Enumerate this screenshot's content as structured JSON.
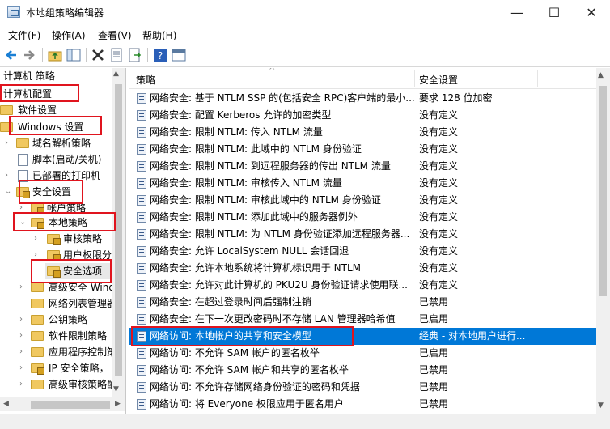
{
  "window": {
    "title": "本地组策略编辑器",
    "minimize_glyph": "—",
    "maximize_glyph": "☐",
    "close_glyph": "✕"
  },
  "menu": [
    "文件(F)",
    "操作(A)",
    "查看(V)",
    "帮助(H)"
  ],
  "toolbar_icons": [
    "back-arrow-icon",
    "forward-arrow-icon",
    "up-folder-icon",
    "show-hide-tree-icon",
    "delete-icon",
    "properties-icon",
    "refresh-icon",
    "export-list-icon",
    "help-icon",
    "help-topics-icon"
  ],
  "tree": {
    "root": "计算机 策略",
    "items": [
      {
        "label": "计算机配置",
        "level": 0
      },
      {
        "label": "软件设置",
        "level": 1
      },
      {
        "label": "Windows 设置",
        "level": 1
      },
      {
        "label": "域名解析策略",
        "level": 2
      },
      {
        "label": "脚本(启动/关机)",
        "level": 2
      },
      {
        "label": "已部署的打印机",
        "level": 2
      },
      {
        "label": "安全设置",
        "level": 2
      },
      {
        "label": "帐户策略",
        "level": 3
      },
      {
        "label": "本地策略",
        "level": 3
      },
      {
        "label": "审核策略",
        "level": 4
      },
      {
        "label": "用户权限分",
        "level": 4
      },
      {
        "label": "安全选项",
        "level": 4
      },
      {
        "label": "高级安全 Wind",
        "level": 3
      },
      {
        "label": "网络列表管理器",
        "level": 3
      },
      {
        "label": "公钥策略",
        "level": 3
      },
      {
        "label": "软件限制策略",
        "level": 3
      },
      {
        "label": "应用程序控制策",
        "level": 3
      },
      {
        "label": "IP 安全策略，",
        "level": 3
      },
      {
        "label": "高级审核策略配",
        "level": 3
      }
    ]
  },
  "list": {
    "col_policy": "策略",
    "col_setting": "安全设置",
    "rows": [
      {
        "policy": "网络安全: 基于 NTLM SSP 的(包括安全 RPC)客户端的最小...",
        "setting": "要求 128 位加密"
      },
      {
        "policy": "网络安全: 配置 Kerberos 允许的加密类型",
        "setting": "没有定义"
      },
      {
        "policy": "网络安全: 限制 NTLM: 传入 NTLM 流量",
        "setting": "没有定义"
      },
      {
        "policy": "网络安全: 限制 NTLM: 此域中的 NTLM 身份验证",
        "setting": "没有定义"
      },
      {
        "policy": "网络安全: 限制 NTLM: 到远程服务器的传出 NTLM 流量",
        "setting": "没有定义"
      },
      {
        "policy": "网络安全: 限制 NTLM: 审核传入 NTLM 流量",
        "setting": "没有定义"
      },
      {
        "policy": "网络安全: 限制 NTLM: 审核此域中的 NTLM 身份验证",
        "setting": "没有定义"
      },
      {
        "policy": "网络安全: 限制 NTLM: 添加此域中的服务器例外",
        "setting": "没有定义"
      },
      {
        "policy": "网络安全: 限制 NTLM: 为 NTLM 身份验证添加远程服务器...",
        "setting": "没有定义"
      },
      {
        "policy": "网络安全: 允许 LocalSystem NULL 会话回退",
        "setting": "没有定义"
      },
      {
        "policy": "网络安全: 允许本地系统将计算机标识用于 NTLM",
        "setting": "没有定义"
      },
      {
        "policy": "网络安全: 允许对此计算机的 PKU2U 身份验证请求使用联...",
        "setting": "没有定义"
      },
      {
        "policy": "网络安全: 在超过登录时间后强制注销",
        "setting": "已禁用"
      },
      {
        "policy": "网络安全: 在下一次更改密码时不存储 LAN 管理器哈希值",
        "setting": "已启用"
      },
      {
        "policy": "网络访问: 本地帐户的共享和安全模型",
        "setting": "经典 - 对本地用户进行..."
      },
      {
        "policy": "网络访问: 不允许 SAM 帐户的匿名枚举",
        "setting": "已启用"
      },
      {
        "policy": "网络访问: 不允许 SAM 帐户和共享的匿名枚举",
        "setting": "已禁用"
      },
      {
        "policy": "网络访问: 不允许存储网络身份验证的密码和凭据",
        "setting": "已禁用"
      },
      {
        "policy": "网络访问: 将 Everyone 权限应用于匿名用户",
        "setting": "已禁用"
      }
    ]
  },
  "colors": {
    "selection": "#0078d7",
    "highlight_box": "#e0141e"
  }
}
